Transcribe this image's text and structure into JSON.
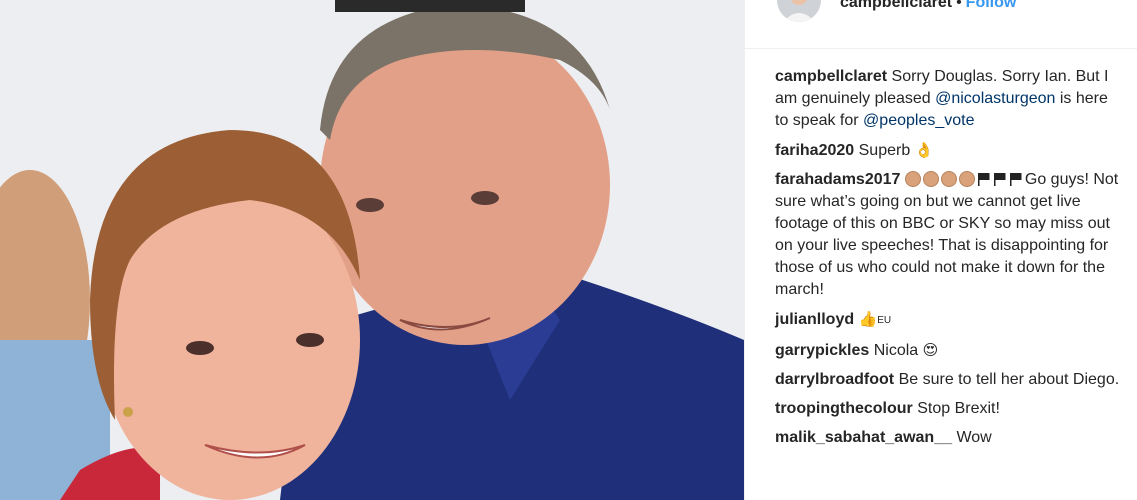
{
  "post": {
    "photo_alt": "",
    "colors": {
      "follow": "#3897f0",
      "mention": "#003569",
      "text": "#262626"
    }
  },
  "header": {
    "username": "campbellclaret",
    "separator": "•",
    "follow_label": "Follow"
  },
  "comments": [
    {
      "user": "campbellclaret",
      "text_1": "Sorry Douglas. Sorry Ian. But I am genuinely pleased ",
      "mention_1": "@nicolasturgeon",
      "text_2": " is here to speak for ",
      "mention_2": "@peoples_vote"
    },
    {
      "user": "fariha2020",
      "text": "Superb",
      "emoji": "👌"
    },
    {
      "user": "farahadams2017",
      "emoji_icons": [
        "clap-icon",
        "clap-icon",
        "clap-icon",
        "clap-icon",
        "black-flag-icon",
        "black-flag-icon",
        "black-flag-icon"
      ],
      "text": "Go guys! Not sure what’s going on but we cannot get live footage of this on BBC or SKY so may miss out on your live speeches! That is disappointing for those of us who could not make it down for the march!"
    },
    {
      "user": "julianlloyd",
      "emoji": "👍",
      "tag": "EU"
    },
    {
      "user": "garrypickles",
      "text": "Nicola",
      "emoji": "😍"
    },
    {
      "user": "darrylbroadfoot",
      "text": "Be sure to tell her about Diego."
    },
    {
      "user": "troopingthecolour",
      "text": "Stop Brexit!"
    },
    {
      "user": "malik_sabahat_awan__",
      "text": "Wow"
    }
  ]
}
